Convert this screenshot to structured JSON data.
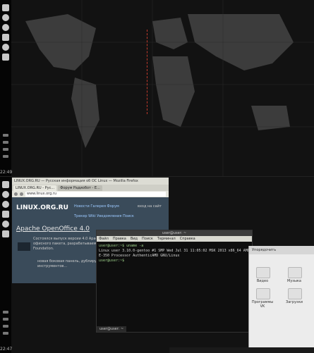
{
  "top_screen": {
    "clock": "22:49"
  },
  "bottom_screen": {
    "clock": "22:47",
    "browser": {
      "title": "LINUX.ORG.RU — Русская информация об ОС Linux — Mozilla Firefox",
      "tabs": [
        "LINUX.ORG.RU - Рус...",
        "Форум Радиобот - Е..."
      ],
      "url": "www.linux.org.ru",
      "site": {
        "logo": "LINUX.ORG.RU",
        "menu_1": "Новости Галерея Форум",
        "menu_2": "Трекер Wiki Уведомления Поиск",
        "login": "вход на сайт",
        "article_title": "Apache OpenOffice 4.0",
        "article_text": "Состоялся выпуск версии 4.0 Apache OpenOffice — свободного офисного пакета, разрабатываемого в рамках Apache Software Foundation.",
        "bullet_text": "новая боковая панель, дублирующая функциональность панели инструментов..."
      }
    },
    "terminal": {
      "title": "user@user: ~",
      "menu": [
        "Файл",
        "Правка",
        "Вид",
        "Поиск",
        "Терминал",
        "Справка"
      ],
      "lines": [
        "user@user:~$ uname -a",
        "Linux user 3.10.0-gentoo #1 SMP Wed Jul 31 11:05:02 MSK 2013 x86_64 AMD",
        "E-350 Processor AuthenticAMD GNU/Linux",
        "user@user:~$ "
      ],
      "tab_label": "user@user: ~"
    },
    "file_manager": {
      "path": "Упорядочить",
      "folders": [
        "Видео",
        "Музыка",
        "Программы VK",
        "Загрузки"
      ]
    }
  }
}
